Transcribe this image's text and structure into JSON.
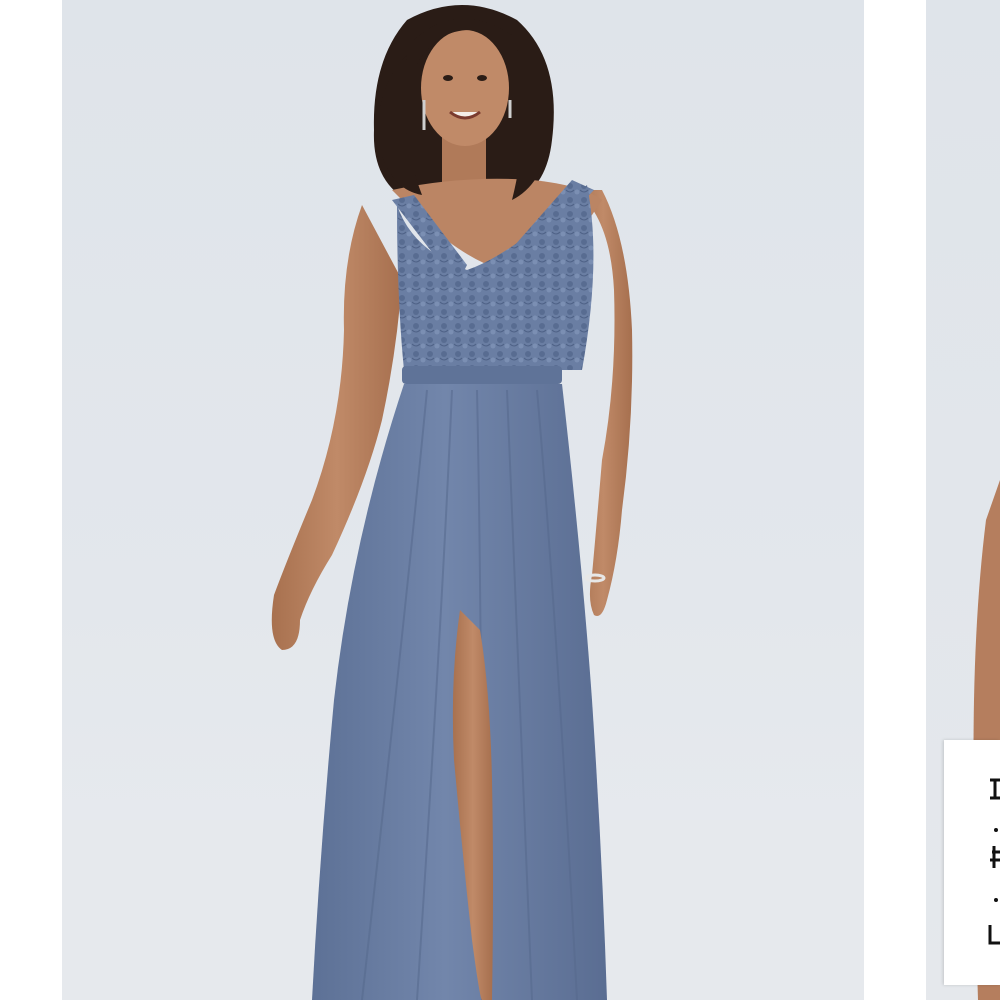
{
  "carousel": {
    "main_slide": {
      "image_alt": "",
      "dress_color": "#6b7fa3"
    },
    "next_slide": {
      "image_alt": ""
    }
  },
  "colors": {
    "backdrop": "#e1e6eb",
    "dress": "#6b7fa3",
    "skin": "#b98363",
    "hair": "#2a1c16"
  }
}
